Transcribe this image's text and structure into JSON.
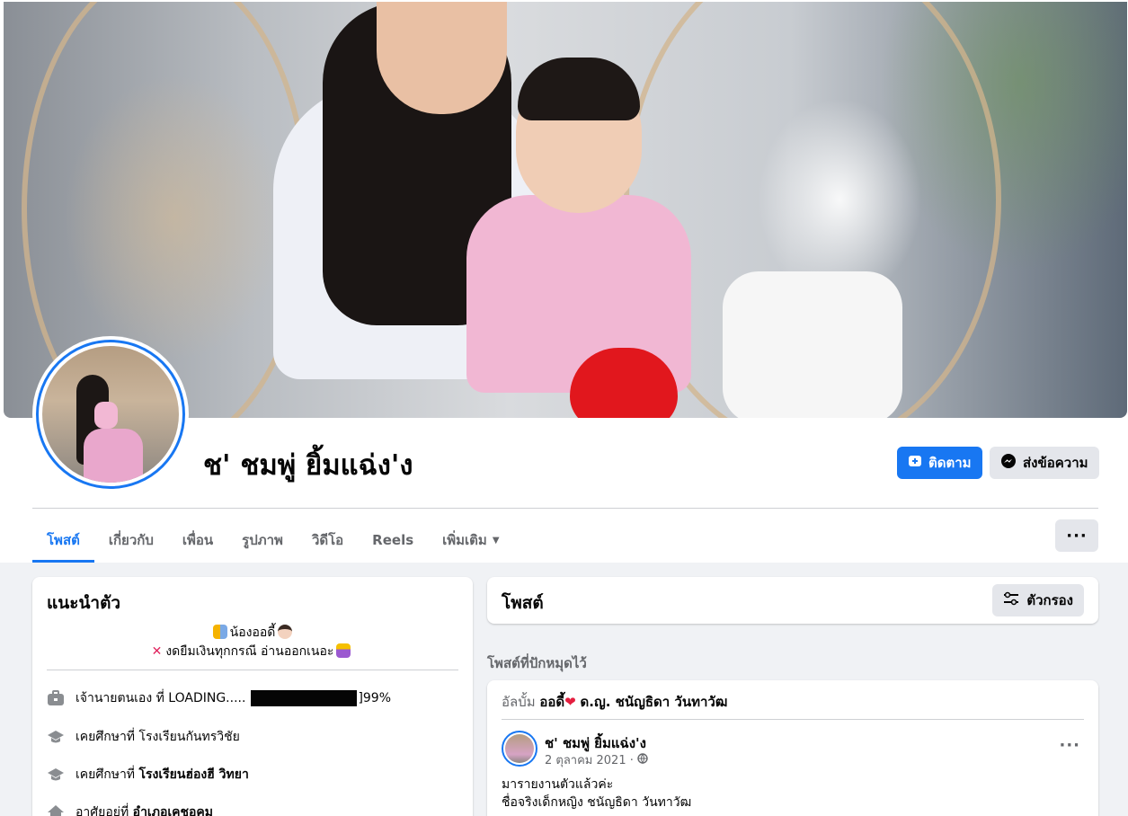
{
  "profile": {
    "name": "ช' ชมพู่ ยิ้มแฉ่ง'ง",
    "follow_label": "ติดตาม",
    "message_label": "ส่งข้อความ"
  },
  "tabs": [
    {
      "label": "โพสต์",
      "active": true
    },
    {
      "label": "เกี่ยวกับ"
    },
    {
      "label": "เพื่อน"
    },
    {
      "label": "รูปภาพ"
    },
    {
      "label": "วิดีโอ"
    },
    {
      "label": "Reels"
    },
    {
      "label": "เพิ่มเติม"
    }
  ],
  "more_label": "···",
  "intro": {
    "title": "แนะนำตัว",
    "bio_line1": "น้องออดี้",
    "bio_line2": "งดยืมเงินทุกกรณี อ่านออกเนอะ",
    "items": [
      {
        "icon": "briefcase-icon",
        "prefix": "เจ้านายตนเอง ที่ LOADING.....",
        "suffix": "]99%"
      },
      {
        "icon": "graduation-cap-icon",
        "prefix": "เคยศึกษาที่",
        "value": "โรงเรียนกันทรวิชัย"
      },
      {
        "icon": "graduation-cap-icon",
        "prefix": "เคยศึกษาที่",
        "value": "โรงเรียนฮ่องฮี วิทยา"
      },
      {
        "icon": "home-icon",
        "prefix": "อาศัยอยู่ที่",
        "value": "อำเภอเคชอคม"
      }
    ]
  },
  "posts": {
    "title": "โพสต์",
    "filter_label": "ตัวกรอง",
    "pinned_label": "โพสต์ที่ปักหมุดไว้"
  },
  "pinned_post": {
    "album_prefix": "อัลบั้ม",
    "album_name": "ออดี้",
    "album_suffix": "ด.ญ. ชนัญธิดา วันทาวัฒ",
    "author": "ช' ชมพู่ ยิ้มแฉ่ง'ง",
    "date": "2 ตุลาคม 2021 ·",
    "more_label": "···",
    "text_line1": "มารายงานตัวแล้วค่ะ",
    "text_line2": "ชื่อจริงเด็กหญิง ชนัญธิดา  วันทาวัฒ"
  },
  "colors": {
    "accent": "#1877f2",
    "background": "#f0f2f5",
    "button_secondary": "#e4e6eb",
    "text_secondary": "#65676b"
  }
}
